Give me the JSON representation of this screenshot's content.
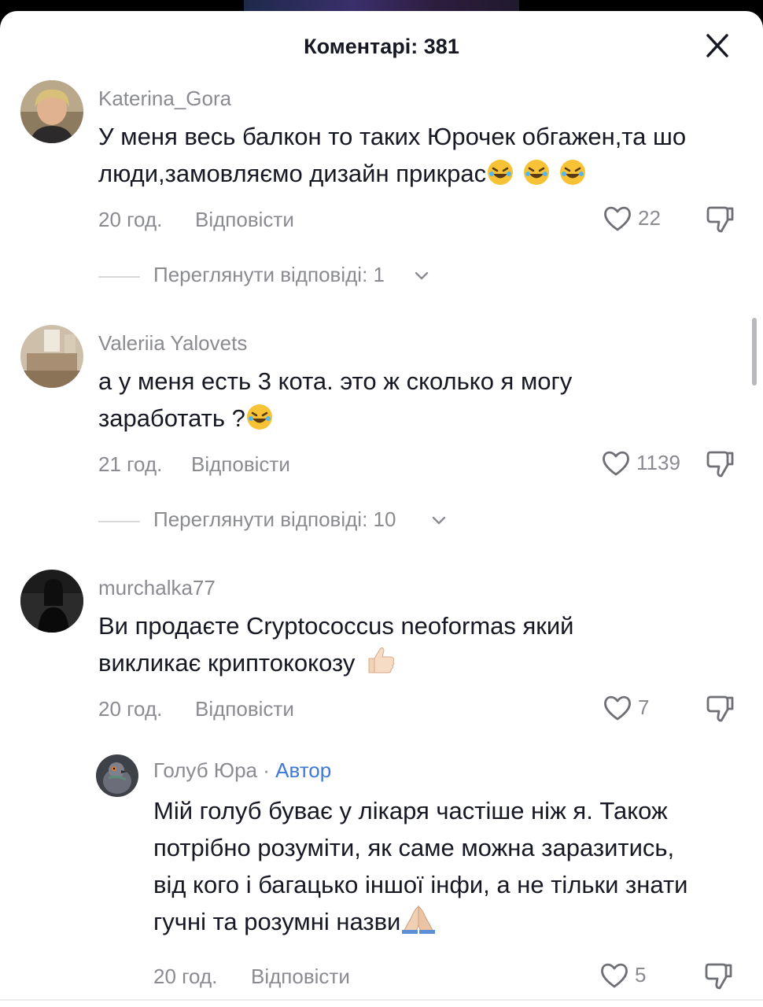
{
  "header": {
    "title": "Коментарі: 381"
  },
  "comments": [
    {
      "username": "Katerina_Gora",
      "lines": [
        "У меня весь балкон то таких Юрочек обгажен,та шо",
        "люди,замовляємо дизайн прикрас"
      ],
      "time": "20 год.",
      "reply": "Відповісти",
      "likes": "22",
      "view_replies": "Переглянути відповіді: 1"
    },
    {
      "username": "Valeriia Yalovets",
      "lines": [
        "а у меня есть 3 кота. это ж сколько я могу",
        "заработать ?"
      ],
      "time": "21 год.",
      "reply": "Відповісти",
      "likes": "1139",
      "view_replies": "Переглянути відповіді: 10"
    },
    {
      "username": "murchalka77",
      "lines": [
        "Ви продаєте Cryptococcus neoformas який",
        "викликає криптококозу"
      ],
      "time": "20 год.",
      "reply": "Відповісти",
      "likes": "7"
    }
  ],
  "reply": {
    "username": "Голуб Юра",
    "separator": " · ",
    "badge": "Автор",
    "lines": [
      "Мій голуб буває у лікаря частіше ніж я. Також",
      "потрібно розуміти, як саме можна заразитись,",
      "від кого і багацько іншої інфи, а не тільки знати",
      "гучні та розумні назви"
    ],
    "time": "20 год.",
    "reply": "Відповісти",
    "likes": "5"
  },
  "emojis": [
    "rolling-on-floor-laughing",
    "thumbs-up",
    "folded-hands"
  ],
  "colors": {
    "muted": "#8a8b91",
    "author_badge": "#3d7ad6",
    "text": "#161823"
  }
}
